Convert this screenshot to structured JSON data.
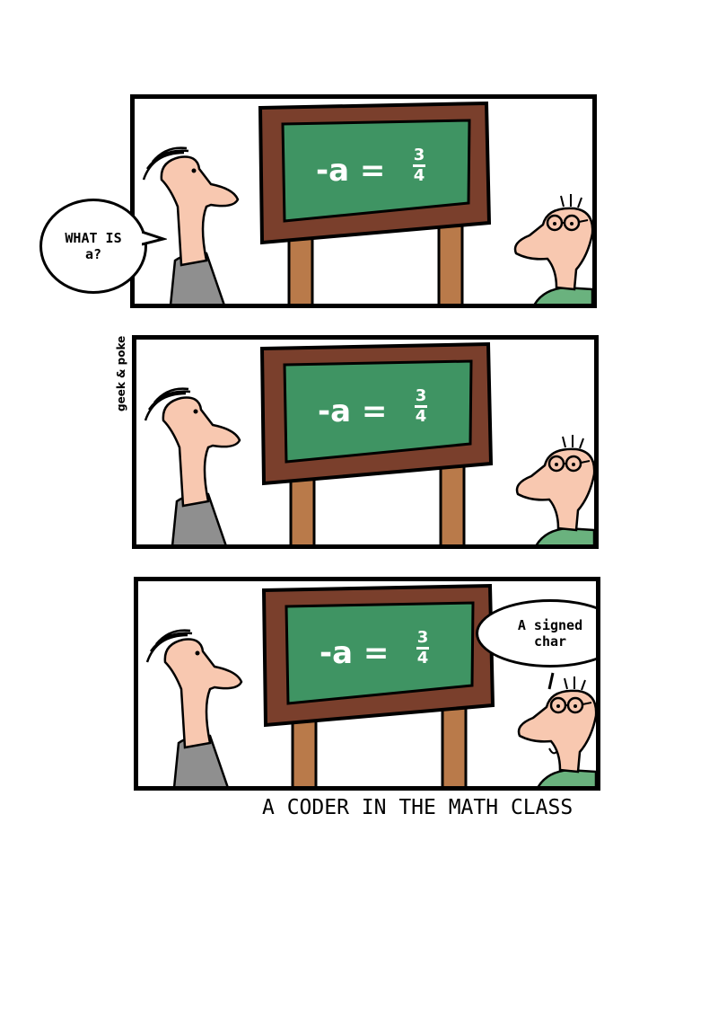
{
  "comic": {
    "credit": "geek & poke",
    "caption": "A CODER IN THE MATH CLASS",
    "blackboard": {
      "equation_left": "-a =",
      "numerator": "3",
      "denominator": "4"
    },
    "panels": [
      {
        "speech": "WHAT IS\na?"
      },
      {
        "speech": ""
      },
      {
        "speech": "A signed\nchar"
      }
    ]
  },
  "colors": {
    "board_frame": "#7a3f2c",
    "board_green": "#3f9463",
    "post": "#b97a4a",
    "skin": "#f8c8b0",
    "teacher_shirt": "#8f8f8f",
    "student_shirt": "#6ab27e"
  },
  "icons": [
    "teacher-figure",
    "student-figure",
    "blackboard",
    "speech-bubble"
  ]
}
